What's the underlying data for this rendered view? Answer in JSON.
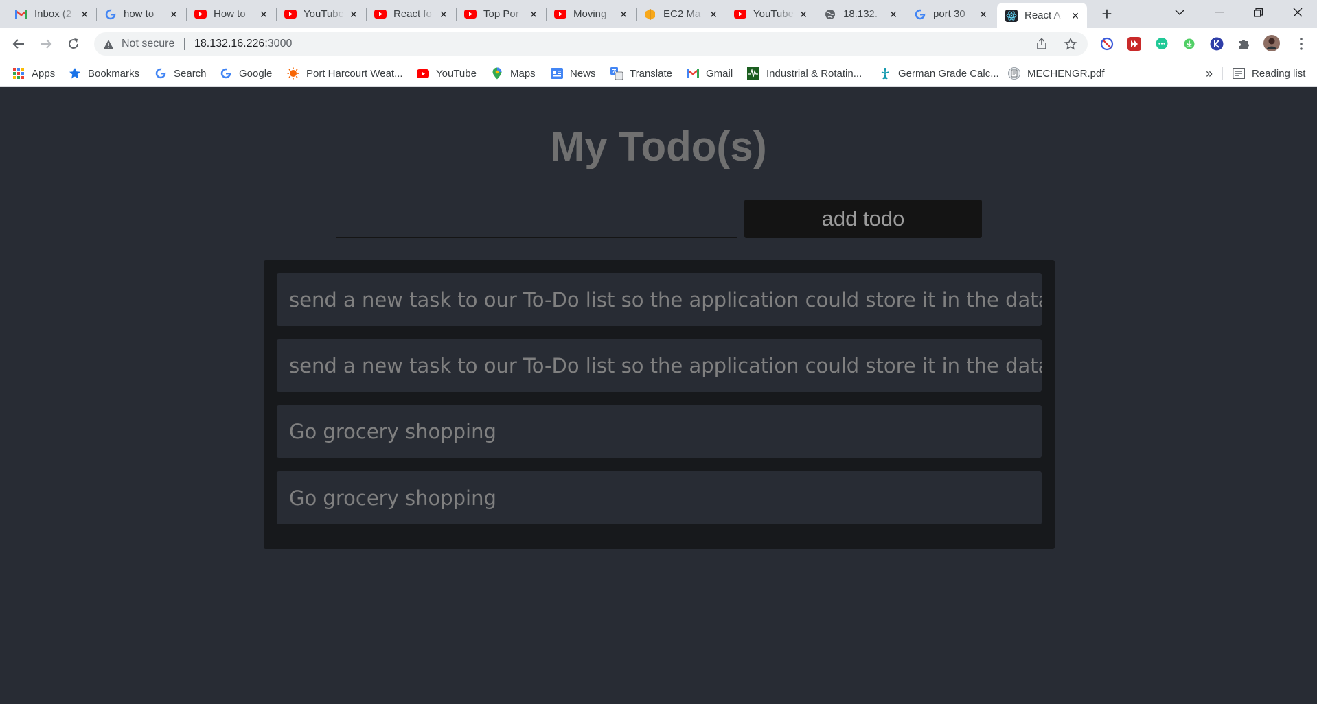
{
  "tabs": [
    {
      "title": "Inbox (2",
      "favicon": "gmail-icon"
    },
    {
      "title": "how to",
      "favicon": "google-icon"
    },
    {
      "title": "How to",
      "favicon": "youtube-icon"
    },
    {
      "title": "YouTube",
      "favicon": "youtube-icon"
    },
    {
      "title": "React fo",
      "favicon": "youtube-icon"
    },
    {
      "title": "Top Por",
      "favicon": "youtube-icon"
    },
    {
      "title": "Moving",
      "favicon": "youtube-icon"
    },
    {
      "title": "EC2 Ma",
      "favicon": "aws-icon"
    },
    {
      "title": "YouTube",
      "favicon": "youtube-icon"
    },
    {
      "title": "18.132.",
      "favicon": "globe-icon"
    },
    {
      "title": "port 30",
      "favicon": "google-icon"
    },
    {
      "title": "React A",
      "favicon": "react-icon",
      "active": true
    }
  ],
  "omnibox": {
    "security_label": "Not secure",
    "url_host": "18.132.16.226",
    "url_port": ":3000"
  },
  "bookmarks": [
    {
      "label": "Apps",
      "icon": "apps-grid-icon"
    },
    {
      "label": "Bookmarks",
      "icon": "star-icon"
    },
    {
      "label": "Search",
      "icon": "google-icon"
    },
    {
      "label": "Google",
      "icon": "google-icon"
    },
    {
      "label": "Port Harcourt Weat...",
      "icon": "weather-icon"
    },
    {
      "label": "YouTube",
      "icon": "youtube-icon"
    },
    {
      "label": "Maps",
      "icon": "maps-icon"
    },
    {
      "label": "News",
      "icon": "news-icon"
    },
    {
      "label": "Translate",
      "icon": "translate-icon"
    },
    {
      "label": "Gmail",
      "icon": "gmail-icon"
    },
    {
      "label": "Industrial & Rotatin...",
      "icon": "waveform-icon"
    },
    {
      "label": "German Grade Calc...",
      "icon": "figure-icon"
    },
    {
      "label": "MECHENGR.pdf",
      "icon": "pdf-icon"
    }
  ],
  "bookmarks_overflow": "»",
  "reading_list": "Reading list",
  "app": {
    "title": "My Todo(s)",
    "input_value": "",
    "add_button_label": "add todo",
    "todos": [
      "send a new task to our To-Do list so the application could store it in the database",
      "send a new task to our To-Do list so the application could store it in the database",
      "Go grocery shopping",
      "Go grocery shopping"
    ]
  },
  "colors": {
    "page_bg": "#282c34",
    "list_bg": "#17191c",
    "button_bg": "#141414",
    "title_color": "#707070",
    "item_text": "#808080"
  }
}
